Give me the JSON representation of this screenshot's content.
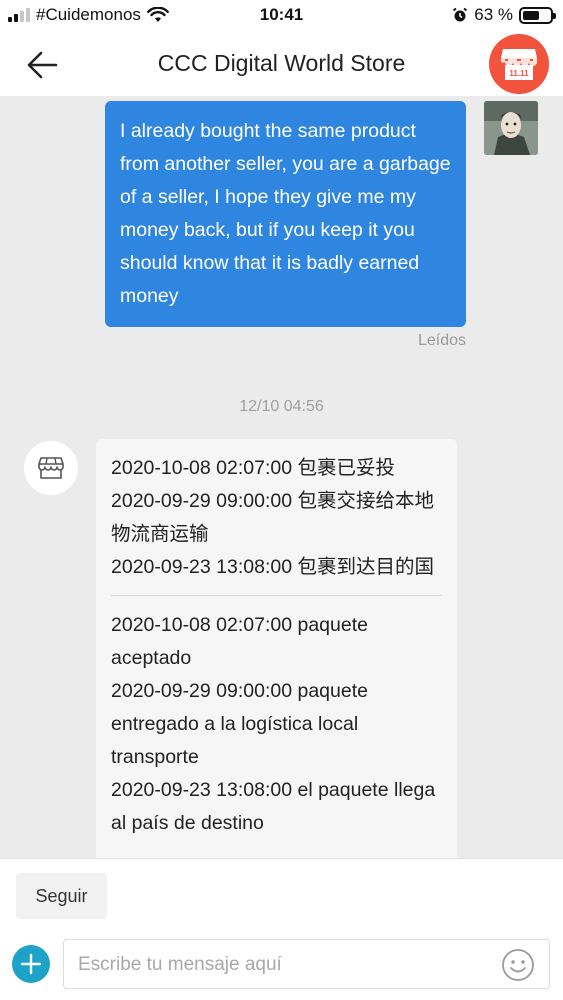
{
  "status_bar": {
    "carrier": "#Cuidemonos",
    "time": "10:41",
    "battery": "63 %",
    "battery_level": 0.63
  },
  "header": {
    "title": "CCC Digital World Store",
    "store_logo_text": "11.11"
  },
  "chat": {
    "outgoing": {
      "text": "I already bought the same product from another seller, you are a garbage of a seller, I hope they give me my money back, but if you keep it you should know that it is badly earned money",
      "status": "Leídos"
    },
    "timestamp": "12/10 04:56",
    "incoming": {
      "lines_cn": [
        "2020-10-08 02:07:00 包裹已妥投",
        "2020-09-29 09:00:00 包裹交接给本地物流商运输",
        "2020-09-23 13:08:00 包裹到达目的国"
      ],
      "lines_es": [
        "2020-10-08 02:07:00 paquete aceptado",
        "2020-09-29 09:00:00 paquete entregado a la logística local transporte",
        "2020-09-23 13:08:00 el paquete llega al país de destino"
      ]
    }
  },
  "footer": {
    "follow_label": "Seguir",
    "input_placeholder": "Escribe tu mensaje aquí"
  }
}
